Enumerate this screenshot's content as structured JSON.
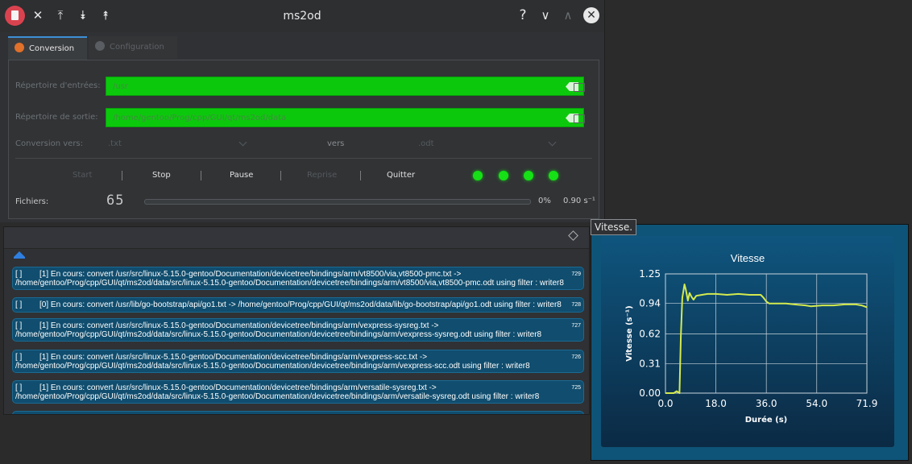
{
  "window": {
    "title": "ms2od"
  },
  "tabs": [
    {
      "label": "Conversion"
    },
    {
      "label": "Configuration"
    }
  ],
  "form": {
    "input_label": "Répertoire d'entrées:",
    "input_value": "/usr",
    "output_label": "Répertoire de sortie:",
    "output_value": "/home/gentoo/Prog/cpp/GUI/qt/ms2od/data",
    "conversion_label": "Conversion vers:",
    "from_format": ".txt",
    "vers_label": "vers",
    "to_format": ".odt"
  },
  "actions": {
    "start": "Start",
    "stop": "Stop",
    "pause": "Pause",
    "resume": "Reprise",
    "quit": "Quitter"
  },
  "status": {
    "files_label": "Fichiers:",
    "files_count": "65",
    "progress_pct": "0%",
    "progress_value": 0,
    "speed": "0.90 s⁻¹"
  },
  "log": {
    "entries": [
      {
        "check": "[ ]",
        "line1": "[1] En cours: convert /usr/src/linux-5.15.0-gentoo/Documentation/devicetree/bindings/arm/vt8500/via,vt8500-pmc.txt ->",
        "line2": "/home/gentoo/Prog/cpp/GUI/qt/ms2od/data/src/linux-5.15.0-gentoo/Documentation/devicetree/bindings/arm/vt8500/via,vt8500-pmc.odt using filter : writer8",
        "num": "729"
      },
      {
        "check": "[ ]",
        "line1": "[0] En cours: convert /usr/lib/go-bootstrap/api/go1.txt -> /home/gentoo/Prog/cpp/GUI/qt/ms2od/data/lib/go-bootstrap/api/go1.odt using filter : writer8",
        "line2": "",
        "num": "728"
      },
      {
        "check": "[ ]",
        "line1": "[1] En cours: convert /usr/src/linux-5.15.0-gentoo/Documentation/devicetree/bindings/arm/vexpress-sysreg.txt ->",
        "line2": "/home/gentoo/Prog/cpp/GUI/qt/ms2od/data/src/linux-5.15.0-gentoo/Documentation/devicetree/bindings/arm/vexpress-sysreg.odt using filter : writer8",
        "num": "727"
      },
      {
        "check": "[ ]",
        "line1": "[1] En cours: convert /usr/src/linux-5.15.0-gentoo/Documentation/devicetree/bindings/arm/vexpress-scc.txt ->",
        "line2": "/home/gentoo/Prog/cpp/GUI/qt/ms2od/data/src/linux-5.15.0-gentoo/Documentation/devicetree/bindings/arm/vexpress-scc.odt using filter : writer8",
        "num": "726"
      },
      {
        "check": "[ ]",
        "line1": "[1] En cours: convert /usr/src/linux-5.15.0-gentoo/Documentation/devicetree/bindings/arm/versatile-sysreg.txt ->",
        "line2": "/home/gentoo/Prog/cpp/GUI/qt/ms2od/data/src/linux-5.15.0-gentoo/Documentation/devicetree/bindings/arm/versatile-sysreg.odt using filter : writer8",
        "num": "725"
      }
    ]
  },
  "tooltip": "Vitesse.",
  "colors": {
    "field_bg": "#0cc80c",
    "led": "#16e016",
    "entry_bg": "#104d6e",
    "curve": "#d4ea4e"
  },
  "icons": {
    "pin": "pin-icon",
    "collapse": "chevrons-up-icon",
    "expand": "chevrons-down-icon",
    "help": "help-icon"
  },
  "chart_data": {
    "type": "line",
    "title": "Vitesse",
    "xlabel": "Durée (s)",
    "ylabel": "Vitesse (s⁻¹)",
    "xlim": [
      0.0,
      71.9
    ],
    "ylim": [
      0.0,
      1.25
    ],
    "xticks": [
      "0.0",
      "18.0",
      "36.0",
      "54.0",
      "71.9"
    ],
    "yticks": [
      "0.00",
      "0.31",
      "0.62",
      "0.94",
      "1.25"
    ],
    "grid": true,
    "series": [
      {
        "x": [
          0,
          3,
          4,
          5,
          5.5,
          6,
          6.8,
          7.3,
          8,
          8.6,
          9.3,
          10,
          11,
          13,
          15,
          18,
          22,
          26,
          30,
          34,
          35,
          36,
          37,
          40,
          43,
          46,
          50,
          52,
          56,
          60,
          64,
          68,
          70,
          71.9
        ],
        "y": [
          0.0,
          0.0,
          0.02,
          0.0,
          0.6,
          1.0,
          1.14,
          1.08,
          0.97,
          1.05,
          1.01,
          0.98,
          1.02,
          1.03,
          1.04,
          1.04,
          1.03,
          1.04,
          1.03,
          1.03,
          1.0,
          0.96,
          0.94,
          0.94,
          0.94,
          0.93,
          0.92,
          0.91,
          0.92,
          0.92,
          0.93,
          0.93,
          0.92,
          0.9
        ]
      }
    ]
  }
}
